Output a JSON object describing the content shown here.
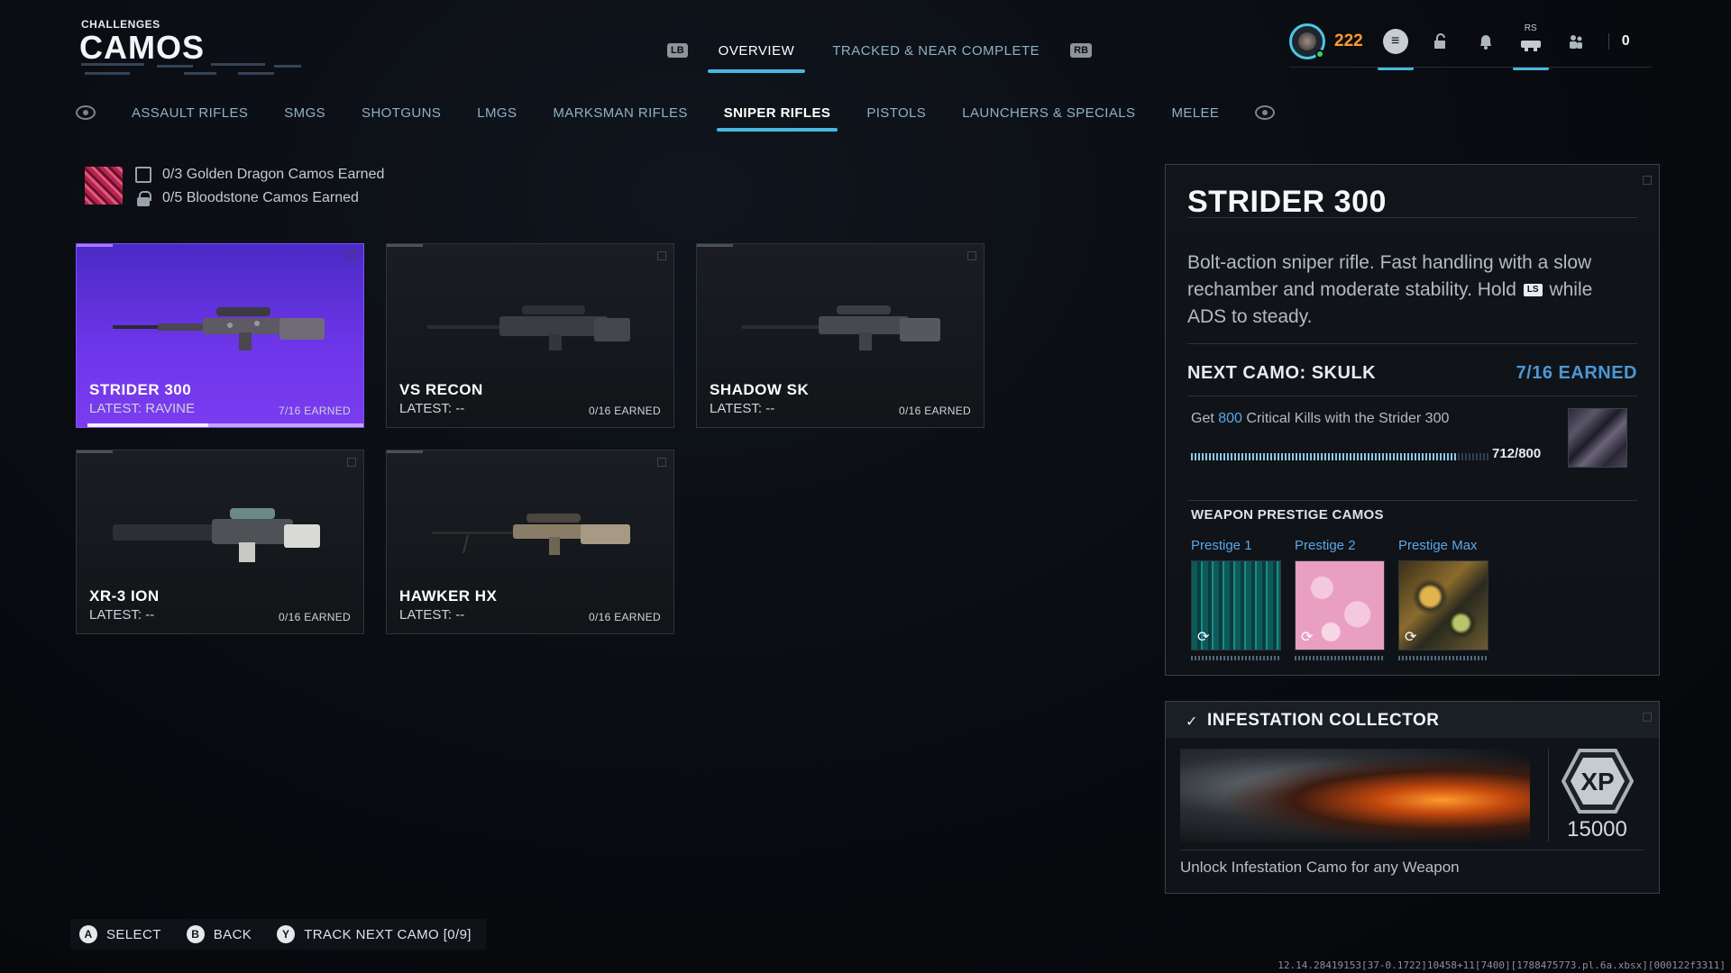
{
  "header": {
    "small_title": "CHALLENGES",
    "title": "CAMOS"
  },
  "top_nav": {
    "left_bumper": "LB",
    "right_bumper": "RB",
    "tabs": [
      {
        "label": "OVERVIEW",
        "active": true
      },
      {
        "label": "TRACKED & NEAR COMPLETE",
        "active": false
      }
    ]
  },
  "status_bar": {
    "points": "222",
    "rs_label": "RS",
    "count": "0",
    "icons": [
      "avatar-icon",
      "menu-icon",
      "lock-icon",
      "bell-icon",
      "controller-icon",
      "party-icon"
    ]
  },
  "category_tabs": [
    {
      "label": "ASSAULT RIFLES",
      "active": false
    },
    {
      "label": "SMGS",
      "active": false
    },
    {
      "label": "SHOTGUNS",
      "active": false
    },
    {
      "label": "LMGS",
      "active": false
    },
    {
      "label": "MARKSMAN RIFLES",
      "active": false
    },
    {
      "label": "SNIPER RIFLES",
      "active": true
    },
    {
      "label": "PISTOLS",
      "active": false
    },
    {
      "label": "LAUNCHERS & SPECIALS",
      "active": false
    },
    {
      "label": "MELEE",
      "active": false
    }
  ],
  "mastery": {
    "golden_dragon": "0/3 Golden Dragon Camos Earned",
    "bloodstone": "0/5 Bloodstone Camos Earned"
  },
  "weapons": [
    {
      "name": "STRIDER 300",
      "latest": "LATEST: RAVINE",
      "earned": "7/16 EARNED",
      "progress": 0.4375,
      "selected": true
    },
    {
      "name": "VS RECON",
      "latest": "LATEST: --",
      "earned": "0/16 EARNED",
      "progress": 0,
      "selected": false
    },
    {
      "name": "SHADOW SK",
      "latest": "LATEST: --",
      "earned": "0/16 EARNED",
      "progress": 0,
      "selected": false
    },
    {
      "name": "XR-3 ION",
      "latest": "LATEST: --",
      "earned": "0/16 EARNED",
      "progress": 0,
      "selected": false
    },
    {
      "name": "HAWKER HX",
      "latest": "LATEST: --",
      "earned": "0/16 EARNED",
      "progress": 0,
      "selected": false
    }
  ],
  "detail": {
    "title": "STRIDER 300",
    "desc_part1": "Bolt-action sniper rifle. Fast handling with a slow rechamber and moderate stability. Hold",
    "ls_chip": "LS",
    "desc_part2": "while ADS to steady.",
    "next_camo": "NEXT CAMO: SKULK",
    "next_earned": "7/16 EARNED",
    "challenge_prefix": "Get",
    "challenge_num": "800",
    "challenge_suffix": "Critical Kills with the Strider 300",
    "progress_text": "712/800",
    "progress_fraction": 0.89,
    "prestige_heading": "WEAPON PRESTIGE CAMOS",
    "prestige": [
      {
        "label": "Prestige 1"
      },
      {
        "label": "Prestige 2"
      },
      {
        "label": "Prestige Max"
      }
    ]
  },
  "reward": {
    "title": "INFESTATION COLLECTOR",
    "xp_label": "XP",
    "xp_value": "15000",
    "description": "Unlock Infestation Camo for any Weapon"
  },
  "footer": {
    "hints": [
      {
        "button": "A",
        "label": "SELECT"
      },
      {
        "button": "B",
        "label": "BACK"
      },
      {
        "button": "Y",
        "label": "TRACK NEXT CAMO [0/9]"
      }
    ]
  },
  "build_info": "12.14.28419153[37-0.1722]10458+11[7400][1788475773.pl.6a.xbsx][000122f3311]",
  "colors": {
    "accent_blue": "#47b8e0",
    "selected_purple": "#6d36e8",
    "points_orange": "#ff9a2e",
    "link_blue": "#5aa7ea"
  }
}
